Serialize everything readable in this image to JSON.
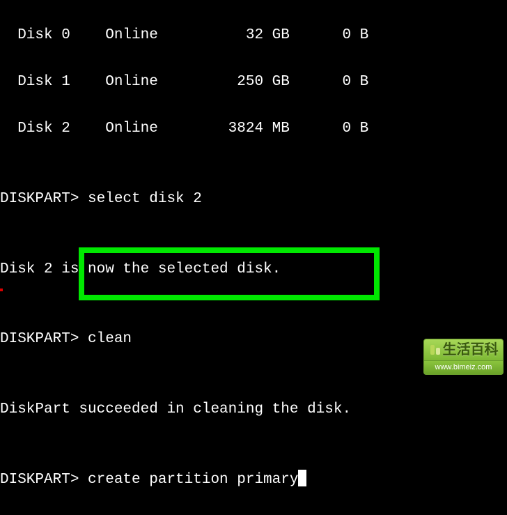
{
  "terminal": {
    "lines": [
      "  Disk 0    Online          32 GB      0 B",
      "  Disk 1    Online         250 GB      0 B",
      "  Disk 2    Online        3824 MB      0 B",
      "",
      "DISKPART> select disk 2",
      "",
      "Disk 2 is now the selected disk.",
      "",
      "DISKPART> clean",
      "",
      "DiskPart succeeded in cleaning the disk.",
      "",
      "DISKPART> create partition primary"
    ]
  },
  "watermark": {
    "title": "生活百科",
    "url": "www.bimeiz.com"
  }
}
